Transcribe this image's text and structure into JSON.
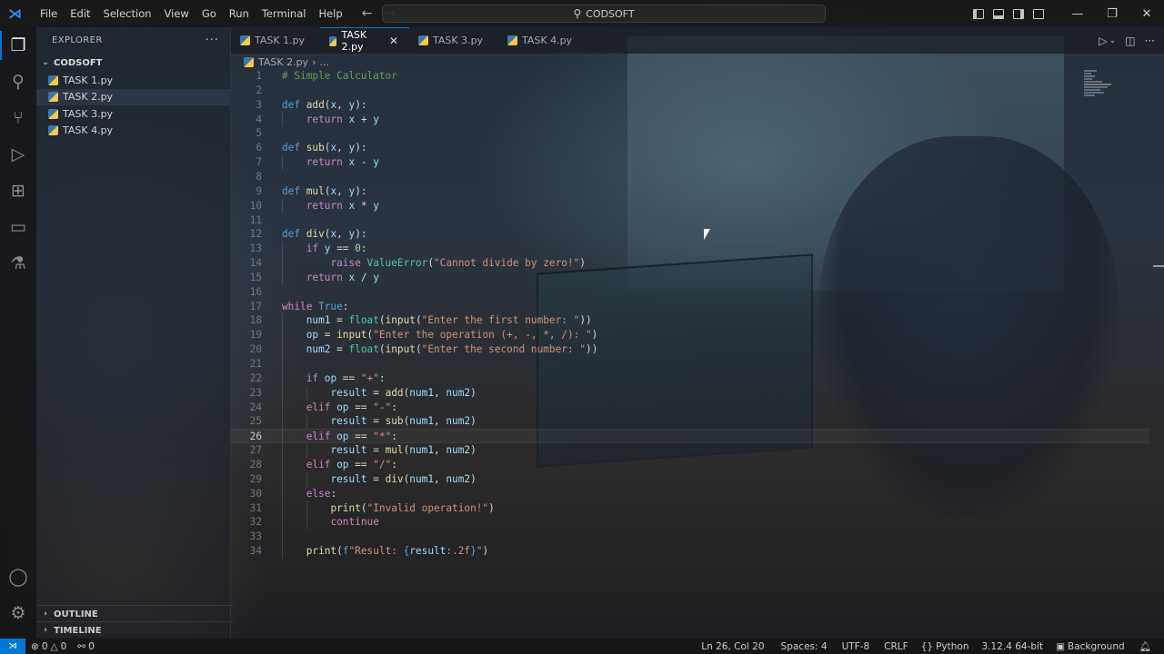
{
  "titlebar": {
    "menu": [
      "File",
      "Edit",
      "Selection",
      "View",
      "Go",
      "Run",
      "Terminal",
      "Help"
    ],
    "search_text": "CODSOFT"
  },
  "sidebar": {
    "header": "EXPLORER",
    "folder": "CODSOFT",
    "files": [
      "TASK 1.py",
      "TASK 2.py",
      "TASK 3.py",
      "TASK 4.py"
    ],
    "selected_file": "TASK 2.py",
    "outline_label": "OUTLINE",
    "timeline_label": "TIMELINE"
  },
  "tabs": [
    {
      "label": "TASK 1.py",
      "active": false
    },
    {
      "label": "TASK 2.py",
      "active": true
    },
    {
      "label": "TASK 3.py",
      "active": false
    },
    {
      "label": "TASK 4.py",
      "active": false
    }
  ],
  "breadcrumb": {
    "file": "TASK 2.py",
    "rest": "..."
  },
  "editor": {
    "current_line": 26,
    "lines": [
      [
        [
          "t-cmt",
          "# Simple Calculator"
        ]
      ],
      [],
      [
        [
          "t-kw",
          "def "
        ],
        [
          "t-fn",
          "add"
        ],
        [
          "t-plain",
          "("
        ],
        [
          "t-var",
          "x"
        ],
        [
          "t-plain",
          ", "
        ],
        [
          "t-var",
          "y"
        ],
        [
          "t-plain",
          "):"
        ]
      ],
      [
        [
          "t-plain",
          "    "
        ],
        [
          "t-ctl",
          "return "
        ],
        [
          "t-var",
          "x"
        ],
        [
          "t-op",
          " + "
        ],
        [
          "t-var",
          "y"
        ]
      ],
      [],
      [
        [
          "t-kw",
          "def "
        ],
        [
          "t-fn",
          "sub"
        ],
        [
          "t-plain",
          "("
        ],
        [
          "t-var",
          "x"
        ],
        [
          "t-plain",
          ", "
        ],
        [
          "t-var",
          "y"
        ],
        [
          "t-plain",
          "):"
        ]
      ],
      [
        [
          "t-plain",
          "    "
        ],
        [
          "t-ctl",
          "return "
        ],
        [
          "t-var",
          "x"
        ],
        [
          "t-op",
          " - "
        ],
        [
          "t-var",
          "y"
        ]
      ],
      [],
      [
        [
          "t-kw",
          "def "
        ],
        [
          "t-fn",
          "mul"
        ],
        [
          "t-plain",
          "("
        ],
        [
          "t-var",
          "x"
        ],
        [
          "t-plain",
          ", "
        ],
        [
          "t-var",
          "y"
        ],
        [
          "t-plain",
          "):"
        ]
      ],
      [
        [
          "t-plain",
          "    "
        ],
        [
          "t-ctl",
          "return "
        ],
        [
          "t-var",
          "x"
        ],
        [
          "t-op",
          " * "
        ],
        [
          "t-var",
          "y"
        ]
      ],
      [],
      [
        [
          "t-kw",
          "def "
        ],
        [
          "t-fn",
          "div"
        ],
        [
          "t-plain",
          "("
        ],
        [
          "t-var",
          "x"
        ],
        [
          "t-plain",
          ", "
        ],
        [
          "t-var",
          "y"
        ],
        [
          "t-plain",
          "):"
        ]
      ],
      [
        [
          "t-plain",
          "    "
        ],
        [
          "t-ctl",
          "if "
        ],
        [
          "t-var",
          "y"
        ],
        [
          "t-op",
          " == "
        ],
        [
          "t-num",
          "0"
        ],
        [
          "t-plain",
          ":"
        ]
      ],
      [
        [
          "t-plain",
          "        "
        ],
        [
          "t-ctl",
          "raise "
        ],
        [
          "t-cls",
          "ValueError"
        ],
        [
          "t-plain",
          "("
        ],
        [
          "t-str",
          "\"Cannot divide by zero!\""
        ],
        [
          "t-plain",
          ")"
        ]
      ],
      [
        [
          "t-plain",
          "    "
        ],
        [
          "t-ctl",
          "return "
        ],
        [
          "t-var",
          "x"
        ],
        [
          "t-op",
          " / "
        ],
        [
          "t-var",
          "y"
        ]
      ],
      [],
      [
        [
          "t-ctl",
          "while "
        ],
        [
          "t-kw",
          "True"
        ],
        [
          "t-plain",
          ":"
        ]
      ],
      [
        [
          "t-plain",
          "    "
        ],
        [
          "t-var",
          "num1"
        ],
        [
          "t-op",
          " = "
        ],
        [
          "t-cls",
          "float"
        ],
        [
          "t-plain",
          "("
        ],
        [
          "t-fn",
          "input"
        ],
        [
          "t-plain",
          "("
        ],
        [
          "t-str",
          "\"Enter the first number: \""
        ],
        [
          "t-plain",
          "))"
        ]
      ],
      [
        [
          "t-plain",
          "    "
        ],
        [
          "t-var",
          "op"
        ],
        [
          "t-op",
          " = "
        ],
        [
          "t-fn",
          "input"
        ],
        [
          "t-plain",
          "("
        ],
        [
          "t-str",
          "\"Enter the operation (+, -, *, /): \""
        ],
        [
          "t-plain",
          ")"
        ]
      ],
      [
        [
          "t-plain",
          "    "
        ],
        [
          "t-var",
          "num2"
        ],
        [
          "t-op",
          " = "
        ],
        [
          "t-cls",
          "float"
        ],
        [
          "t-plain",
          "("
        ],
        [
          "t-fn",
          "input"
        ],
        [
          "t-plain",
          "("
        ],
        [
          "t-str",
          "\"Enter the second number: \""
        ],
        [
          "t-plain",
          "))"
        ]
      ],
      [],
      [
        [
          "t-plain",
          "    "
        ],
        [
          "t-ctl",
          "if "
        ],
        [
          "t-var",
          "op"
        ],
        [
          "t-op",
          " == "
        ],
        [
          "t-str",
          "\"+\""
        ],
        [
          "t-plain",
          ":"
        ]
      ],
      [
        [
          "t-plain",
          "        "
        ],
        [
          "t-var",
          "result"
        ],
        [
          "t-op",
          " = "
        ],
        [
          "t-fn",
          "add"
        ],
        [
          "t-plain",
          "("
        ],
        [
          "t-var",
          "num1"
        ],
        [
          "t-plain",
          ", "
        ],
        [
          "t-var",
          "num2"
        ],
        [
          "t-plain",
          ")"
        ]
      ],
      [
        [
          "t-plain",
          "    "
        ],
        [
          "t-ctl",
          "elif "
        ],
        [
          "t-var",
          "op"
        ],
        [
          "t-op",
          " == "
        ],
        [
          "t-str",
          "\"-\""
        ],
        [
          "t-plain",
          ":"
        ]
      ],
      [
        [
          "t-plain",
          "        "
        ],
        [
          "t-var",
          "result"
        ],
        [
          "t-op",
          " = "
        ],
        [
          "t-fn",
          "sub"
        ],
        [
          "t-plain",
          "("
        ],
        [
          "t-var",
          "num1"
        ],
        [
          "t-plain",
          ", "
        ],
        [
          "t-var",
          "num2"
        ],
        [
          "t-plain",
          ")"
        ]
      ],
      [
        [
          "t-plain",
          "    "
        ],
        [
          "t-ctl",
          "elif "
        ],
        [
          "t-var",
          "op"
        ],
        [
          "t-op",
          " == "
        ],
        [
          "t-str",
          "\"*\""
        ],
        [
          "t-plain",
          ":"
        ]
      ],
      [
        [
          "t-plain",
          "        "
        ],
        [
          "t-var",
          "result"
        ],
        [
          "t-op",
          " = "
        ],
        [
          "t-fn",
          "mul"
        ],
        [
          "t-plain",
          "("
        ],
        [
          "t-var",
          "num1"
        ],
        [
          "t-plain",
          ", "
        ],
        [
          "t-var",
          "num2"
        ],
        [
          "t-plain",
          ")"
        ]
      ],
      [
        [
          "t-plain",
          "    "
        ],
        [
          "t-ctl",
          "elif "
        ],
        [
          "t-var",
          "op"
        ],
        [
          "t-op",
          " == "
        ],
        [
          "t-str",
          "\"/\""
        ],
        [
          "t-plain",
          ":"
        ]
      ],
      [
        [
          "t-plain",
          "        "
        ],
        [
          "t-var",
          "result"
        ],
        [
          "t-op",
          " = "
        ],
        [
          "t-fn",
          "div"
        ],
        [
          "t-plain",
          "("
        ],
        [
          "t-var",
          "num1"
        ],
        [
          "t-plain",
          ", "
        ],
        [
          "t-var",
          "num2"
        ],
        [
          "t-plain",
          ")"
        ]
      ],
      [
        [
          "t-plain",
          "    "
        ],
        [
          "t-ctl",
          "else"
        ],
        [
          "t-plain",
          ":"
        ]
      ],
      [
        [
          "t-plain",
          "        "
        ],
        [
          "t-fn",
          "print"
        ],
        [
          "t-plain",
          "("
        ],
        [
          "t-str",
          "\"Invalid operation!\""
        ],
        [
          "t-plain",
          ")"
        ]
      ],
      [
        [
          "t-plain",
          "        "
        ],
        [
          "t-ctl",
          "continue"
        ]
      ],
      [],
      [
        [
          "t-plain",
          "    "
        ],
        [
          "t-fn",
          "print"
        ],
        [
          "t-plain",
          "("
        ],
        [
          "t-kw",
          "f"
        ],
        [
          "t-str",
          "\"Result: "
        ],
        [
          "t-kw",
          "{"
        ],
        [
          "t-var",
          "result"
        ],
        [
          "t-str",
          ":.2f"
        ],
        [
          "t-kw",
          "}"
        ],
        [
          "t-str",
          "\""
        ],
        [
          "t-plain",
          ")"
        ]
      ]
    ]
  },
  "statusbar": {
    "errors": "0",
    "warnings": "0",
    "ports": "0",
    "position": "Ln 26, Col 20",
    "spaces": "Spaces: 4",
    "encoding": "UTF-8",
    "eol": "CRLF",
    "language": "Python",
    "interpreter": "3.12.4 64-bit",
    "background": "Background"
  },
  "colors": {
    "accent": "#0078d4",
    "keyword": "#569cd6",
    "control": "#c586c0",
    "function": "#dcdcaa",
    "string": "#ce9178",
    "number": "#b5cea8",
    "comment": "#6a9955",
    "variable": "#9cdcfe",
    "class": "#4ec9b0"
  },
  "icons": [
    "vscode-logo-icon",
    "files-icon",
    "search-icon",
    "source-control-icon",
    "run-debug-icon",
    "extensions-icon",
    "remote-explorer-icon",
    "testing-icon",
    "account-icon",
    "settings-gear-icon",
    "python-file-icon",
    "run-icon",
    "split-editor-icon",
    "bell-icon"
  ]
}
